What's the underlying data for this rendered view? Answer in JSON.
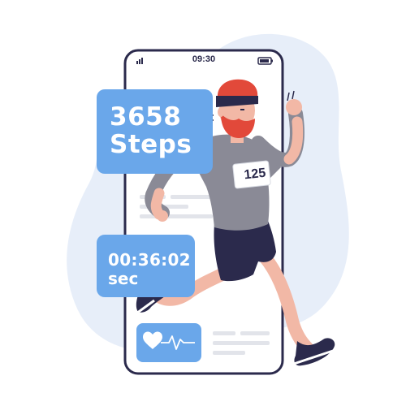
{
  "status_bar": {
    "time": "09:30",
    "signal_icon": "signal-bars-icon",
    "battery_icon": "battery-icon"
  },
  "steps_card": {
    "value": "3658",
    "unit": "Steps"
  },
  "timer_card": {
    "value": "00:36:02",
    "unit": "sec"
  },
  "runner": {
    "bib_number": "125"
  },
  "heart_card": {
    "icon": "heart-pulse-icon"
  },
  "colors": {
    "accent_blue": "#6aa7ea",
    "blob_background": "#e7eef9",
    "phone_outline": "#2b2a4c",
    "shirt": "#8a8a96",
    "shorts": "#2b2a4c",
    "skin": "#f2b8a6",
    "hair": "#e2493a"
  }
}
